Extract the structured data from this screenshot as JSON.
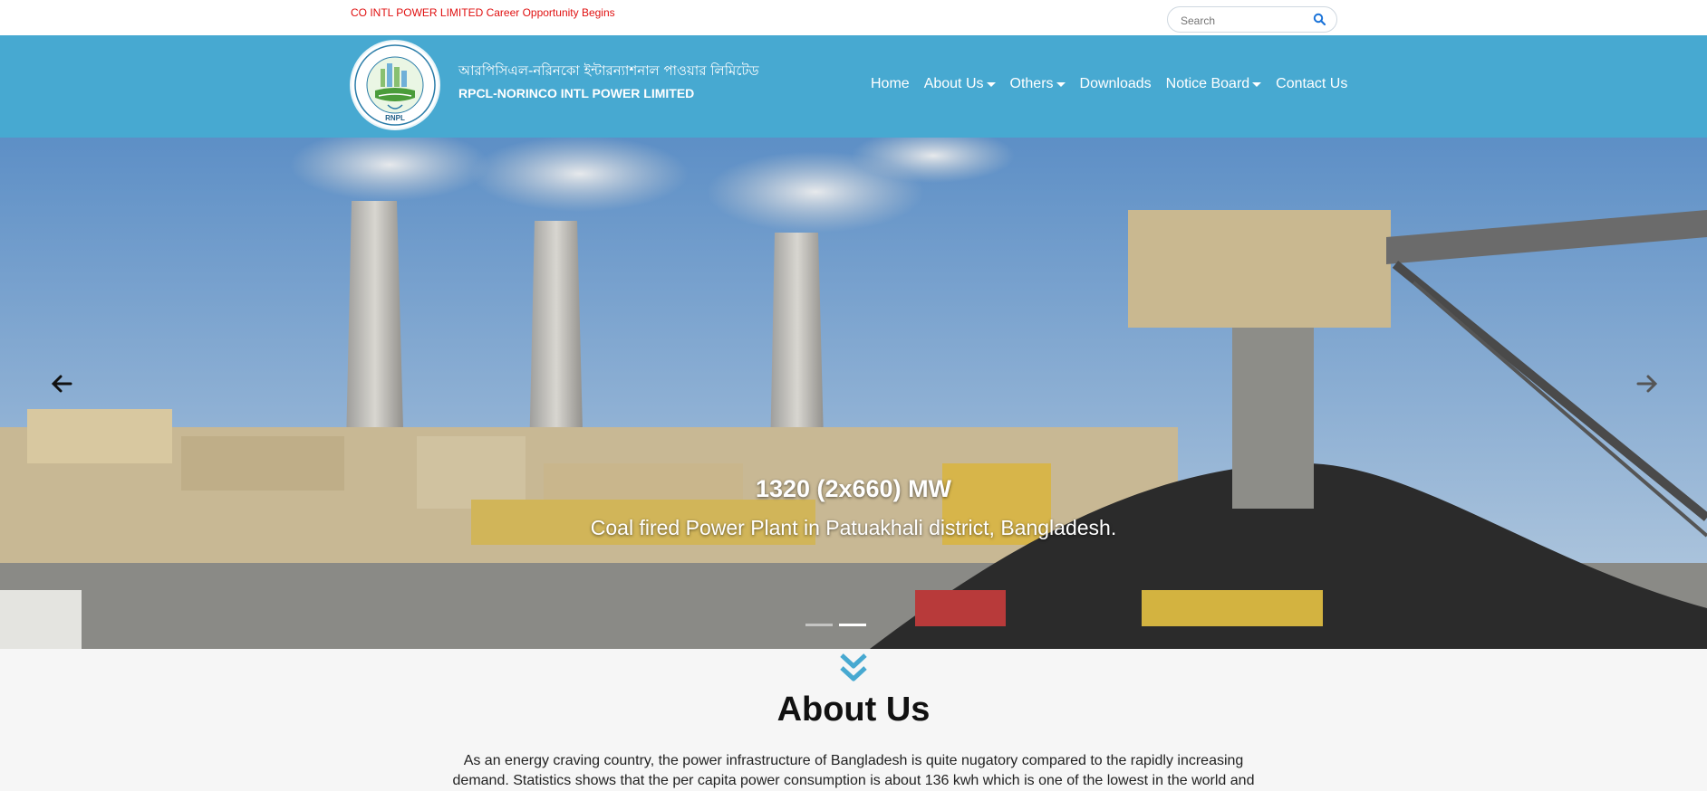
{
  "topbar": {
    "marquee": "CO INTL POWER LIMITED Career Opportunity Begins",
    "search_placeholder": "Search"
  },
  "brand": {
    "name_bn": "আরপিসিএল-নরিনকো ইন্টারন্যাশনাল পাওয়ার লিমিটেড",
    "name_en": "RPCL-NORINCO INTL POWER LIMITED",
    "logo_text": "RNPL"
  },
  "nav": {
    "items": [
      {
        "label": "Home",
        "dropdown": false
      },
      {
        "label": "About Us",
        "dropdown": true
      },
      {
        "label": "Others",
        "dropdown": true
      },
      {
        "label": "Downloads",
        "dropdown": false
      },
      {
        "label": "Notice Board",
        "dropdown": true
      },
      {
        "label": "Contact Us",
        "dropdown": false
      }
    ]
  },
  "hero": {
    "title": "1320 (2x660) MW",
    "subtitle": "Coal fired Power Plant in Patuakhali district, Bangladesh.",
    "slides": 2,
    "active_slide": 1
  },
  "about": {
    "title": "About Us",
    "text": "As an energy craving country, the power infrastructure of Bangladesh is quite nugatory compared to the rapidly increasing demand. Statistics shows that the per capita power consumption is about 136 kwh which is one of the lowest in the world and"
  },
  "colors": {
    "nav_bg": "#47a9d1",
    "marquee": "#e01010",
    "accent": "#47a9d1"
  }
}
